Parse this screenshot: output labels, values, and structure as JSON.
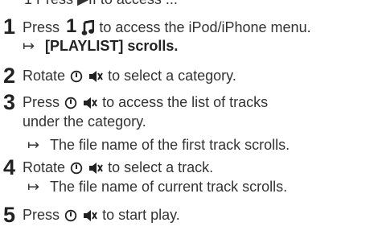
{
  "top_partial": "1  Press  ▶II  to access  ...",
  "steps": [
    {
      "number": "1",
      "prefix": "Press",
      "key_digit": "1",
      "icon": "music-note-icon",
      "suffix": "to access the iPod/iPhone menu.",
      "result_arrow": "↦",
      "result": "[PLAYLIST] scrolls."
    },
    {
      "number": "2",
      "prefix": "Rotate",
      "icons": [
        "power-dial-icon",
        "mute-speaker-icon"
      ],
      "suffix": "to select a category."
    },
    {
      "number": "3",
      "prefix": "Press",
      "icons": [
        "power-dial-icon",
        "mute-speaker-icon"
      ],
      "suffix": "to access the list of tracks",
      "continuation": "under the category.",
      "result_arrow": "↦",
      "result": "The file name of the first track scrolls."
    },
    {
      "number": "4",
      "prefix": "Rotate",
      "icons": [
        "power-dial-icon",
        "mute-speaker-icon"
      ],
      "suffix": "to select a track.",
      "result_arrow": "↦",
      "result": "The file name of current track scrolls."
    },
    {
      "number": "5",
      "prefix": "Press",
      "icons": [
        "power-dial-icon",
        "mute-speaker-icon"
      ],
      "suffix": "to start play."
    }
  ]
}
